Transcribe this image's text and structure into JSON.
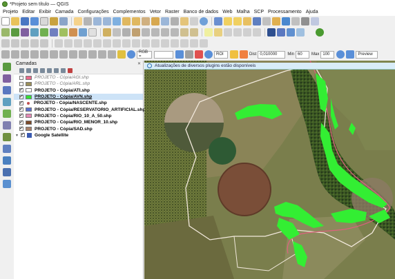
{
  "window": {
    "title": "*Projeto sem título — QGIS"
  },
  "menu": [
    "Projeto",
    "Editar",
    "Exibir",
    "Camada",
    "Configurações",
    "Complementos",
    "Vetor",
    "Raster",
    "Banco de dados",
    "Web",
    "Malha",
    "SCP",
    "Processamento",
    "Ajuda"
  ],
  "scp_toolbar": {
    "rgb_label": "RGB =",
    "roi_label": "ROI",
    "dist_label": "Dist",
    "dist_value": "0,010000",
    "min_label": "Min",
    "min_value": "60",
    "max_label": "Max",
    "max_value": "100",
    "preview_label": "Preview"
  },
  "layers_panel": {
    "title": "Camadas",
    "layers": [
      {
        "name": "PROJETO - Cópia/AGI.shp",
        "checked": false,
        "swatch": "#e86a8a",
        "style": "grey"
      },
      {
        "name": "PROJETO - Cópia/ARL.shp",
        "checked": false,
        "swatch": "#9b8f58",
        "style": "grey"
      },
      {
        "name": "PROJETO - Cópia/ATI.shp",
        "checked": true,
        "swatch": "#ffffff",
        "style": "normal"
      },
      {
        "name": "PROJETO - Cópia/AVN.shp",
        "checked": true,
        "swatch": "#33e033",
        "style": "selected"
      },
      {
        "name": "PROJETO - Cópia/NASCENTE.shp",
        "checked": true,
        "swatch": "dot",
        "style": "normal"
      },
      {
        "name": "PROJETO - Cópia/RESERVATORIO_ARTIFICIAL.shp",
        "checked": true,
        "swatch": "#5b6fcf",
        "style": "normal"
      },
      {
        "name": "PROJETO - Cópia/RIO_10_A_50.shp",
        "checked": true,
        "swatch": "#e58ab5",
        "style": "normal"
      },
      {
        "name": "PROJETO - Cópia/RIO_MENOR_10.shp",
        "checked": true,
        "swatch": "#7c4a2a",
        "style": "normal"
      },
      {
        "name": "PROJETO - Cópia/SAD.shp",
        "checked": true,
        "swatch": "#a9826b",
        "style": "normal"
      },
      {
        "name": "Google Satellite",
        "checked": true,
        "swatch": "grid",
        "style": "group"
      }
    ]
  },
  "map": {
    "notice": "Atualizações de diversos plugins estão disponíveis"
  },
  "colors": {
    "vegetation": "#33ee33",
    "boundary": "#f2e9dc",
    "river": "#e06080"
  }
}
